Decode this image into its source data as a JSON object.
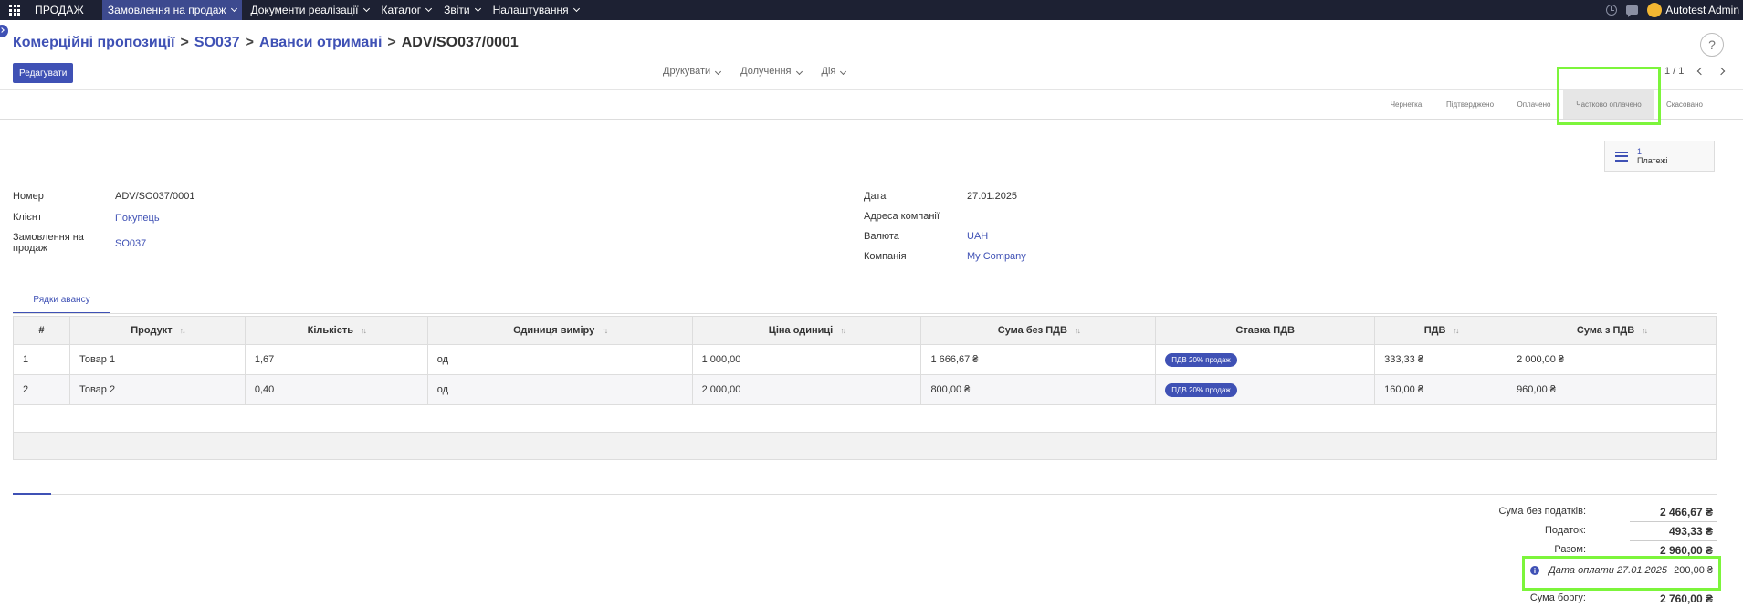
{
  "topbar": {
    "app_name": "ПРОДАЖ",
    "menu": [
      {
        "label": "Замовлення на продаж",
        "active": true
      },
      {
        "label": "Документи реалізації"
      },
      {
        "label": "Каталог"
      },
      {
        "label": "Звіти"
      },
      {
        "label": "Налаштування"
      }
    ],
    "user": "Autotest Admin"
  },
  "breadcrumb": {
    "items": [
      "Комерційні пропозиції",
      "SO037",
      "Аванси отримані"
    ],
    "current": "ADV/SO037/0001"
  },
  "help_label": "?",
  "toolbar": {
    "edit_label": "Редагувати",
    "print_label": "Друкувати",
    "attach_label": "Долучення",
    "action_label": "Дія",
    "pager": "1 / 1"
  },
  "statusbar": {
    "stages": [
      "Чернетка",
      "Підтверджено",
      "Оплачено",
      "Частково оплачено",
      "Скасовано"
    ],
    "current": "Частково оплачено"
  },
  "smart_button": {
    "count": "1",
    "label": "Платежі"
  },
  "form": {
    "number_label": "Номер",
    "number_value": "ADV/SO037/0001",
    "client_label": "Клієнт",
    "client_value": "Покупець",
    "order_label": "Замовлення на продаж",
    "order_value": "SO037",
    "date_label": "Дата",
    "date_value": "27.01.2025",
    "address_label": "Адреса компанії",
    "currency_label": "Валюта",
    "currency_value": "UAH",
    "company_label": "Компанія",
    "company_value": "My Company"
  },
  "tab_label": "Рядки авансу",
  "table": {
    "headers": [
      "#",
      "Продукт",
      "Кількість",
      "Одиниця виміру",
      "Ціна одиниці",
      "Сума без ПДВ",
      "Ставка ПДВ",
      "ПДВ",
      "Сума з ПДВ"
    ],
    "rows": [
      {
        "num": "1",
        "product": "Товар 1",
        "qty": "1,67",
        "uom": "од",
        "price": "1 000,00",
        "subtotal": "1 666,67 ₴",
        "tax": "ПДВ 20% продаж",
        "vat": "333,33 ₴",
        "total": "2 000,00 ₴"
      },
      {
        "num": "2",
        "product": "Товар 2",
        "qty": "0,40",
        "uom": "од",
        "price": "2 000,00",
        "subtotal": "800,00 ₴",
        "tax": "ПДВ 20% продаж",
        "vat": "160,00 ₴",
        "total": "960,00 ₴"
      }
    ]
  },
  "totals": {
    "untaxed_label": "Сума без податків:",
    "untaxed_value": "2 466,67 ₴",
    "tax_label": "Податок:",
    "tax_value": "493,33 ₴",
    "total_label": "Разом:",
    "total_value": "2 960,00 ₴",
    "payment_text": "Дата оплати 27.01.2025",
    "payment_amount": "200,00 ₴",
    "due_label": "Сума боргу:",
    "due_value": "2 760,00 ₴"
  },
  "colors": {
    "accent": "#3f51b5",
    "topbar": "#1d2133",
    "highlight": "#7cf53b"
  }
}
